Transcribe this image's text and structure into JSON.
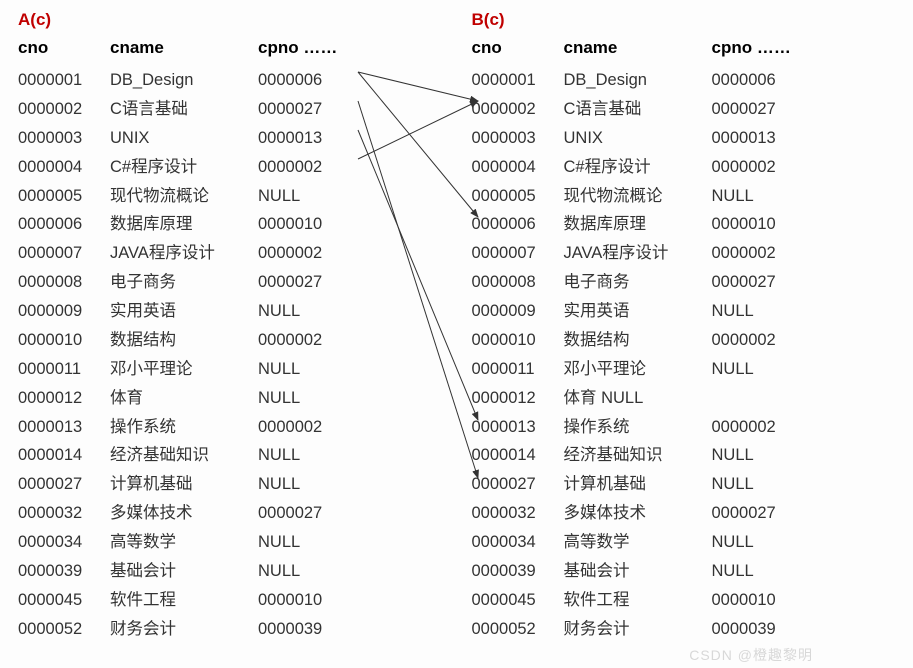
{
  "blocks": [
    {
      "title": "A(c)",
      "headers": {
        "cno": "cno",
        "cname": "cname",
        "cpno": "cpno ……"
      },
      "rows": [
        {
          "cno": "0000001",
          "cname": "DB_Design",
          "cpno": "0000006"
        },
        {
          "cno": "0000002",
          "cname": "C语言基础",
          "cpno": "0000027"
        },
        {
          "cno": "0000003",
          "cname": "UNIX",
          "cpno": "0000013"
        },
        {
          "cno": "0000004",
          "cname": "C#程序设计",
          "cpno": "0000002"
        },
        {
          "cno": "0000005",
          "cname": "现代物流概论",
          "cpno": "NULL"
        },
        {
          "cno": "0000006",
          "cname": "数据库原理",
          "cpno": "0000010"
        },
        {
          "cno": "0000007",
          "cname": "JAVA程序设计",
          "cpno": "0000002"
        },
        {
          "cno": "0000008",
          "cname": "电子商务",
          "cpno": "0000027"
        },
        {
          "cno": "0000009",
          "cname": "实用英语",
          "cpno": "NULL"
        },
        {
          "cno": "0000010",
          "cname": "数据结构",
          "cpno": "0000002"
        },
        {
          "cno": "0000011",
          "cname": "邓小平理论",
          "cpno": "NULL"
        },
        {
          "cno": "0000012",
          "cname": "体育",
          "cpno": "NULL"
        },
        {
          "cno": "0000013",
          "cname": "操作系统",
          "cpno": "0000002"
        },
        {
          "cno": "0000014",
          "cname": "经济基础知识",
          "cpno": "NULL"
        },
        {
          "cno": "0000027",
          "cname": "计算机基础",
          "cpno": "NULL"
        },
        {
          "cno": "0000032",
          "cname": "多媒体技术",
          "cpno": "0000027"
        },
        {
          "cno": "0000034",
          "cname": "高等数学",
          "cpno": "NULL"
        },
        {
          "cno": "0000039",
          "cname": "基础会计",
          "cpno": "NULL"
        },
        {
          "cno": "0000045",
          "cname": "软件工程",
          "cpno": "0000010"
        },
        {
          "cno": "0000052",
          "cname": "财务会计",
          "cpno": "0000039"
        }
      ]
    },
    {
      "title": "B(c)",
      "headers": {
        "cno": "cno",
        "cname": "cname",
        "cpno": "cpno ……"
      },
      "rows": [
        {
          "cno": "0000001",
          "cname": "DB_Design",
          "cpno": "0000006"
        },
        {
          "cno": "0000002",
          "cname": "C语言基础",
          "cpno": "0000027"
        },
        {
          "cno": "0000003",
          "cname": "UNIX",
          "cpno": "0000013"
        },
        {
          "cno": "0000004",
          "cname": "C#程序设计",
          "cpno": "0000002"
        },
        {
          "cno": "0000005",
          "cname": "现代物流概论",
          "cpno": "NULL"
        },
        {
          "cno": "0000006",
          "cname": "数据库原理",
          "cpno": "0000010"
        },
        {
          "cno": "0000007",
          "cname": "JAVA程序设计",
          "cpno": "0000002"
        },
        {
          "cno": "0000008",
          "cname": "电子商务",
          "cpno": "0000027"
        },
        {
          "cno": "0000009",
          "cname": "实用英语",
          "cpno": "NULL"
        },
        {
          "cno": "0000010",
          "cname": "数据结构",
          "cpno": "0000002"
        },
        {
          "cno": "0000011",
          "cname": "邓小平理论",
          "cpno": "NULL"
        },
        {
          "cno": "0000012",
          "cname": "体育        NULL",
          "cpno": ""
        },
        {
          "cno": "0000013",
          "cname": "操作系统",
          "cpno": "0000002"
        },
        {
          "cno": "0000014",
          "cname": "经济基础知识",
          "cpno": "NULL"
        },
        {
          "cno": "0000027",
          "cname": "计算机基础",
          "cpno": "NULL"
        },
        {
          "cno": "0000032",
          "cname": "多媒体技术",
          "cpno": "0000027"
        },
        {
          "cno": "0000034",
          "cname": "高等数学",
          "cpno": "NULL"
        },
        {
          "cno": "0000039",
          "cname": "基础会计",
          "cpno": "NULL"
        },
        {
          "cno": "0000045",
          "cname": "软件工程",
          "cpno": "0000010"
        },
        {
          "cno": "0000052",
          "cname": "财务会计",
          "cpno": "0000039"
        }
      ]
    }
  ],
  "watermark": "CSDN @橙趣黎明",
  "arrows": [
    {
      "from_row": 0,
      "to_row": 5
    },
    {
      "from_row": 0,
      "to_row": 1
    },
    {
      "from_row": 1,
      "to_row": 14
    },
    {
      "from_row": 2,
      "to_row": 12
    },
    {
      "from_row": 3,
      "to_row": 1
    }
  ]
}
